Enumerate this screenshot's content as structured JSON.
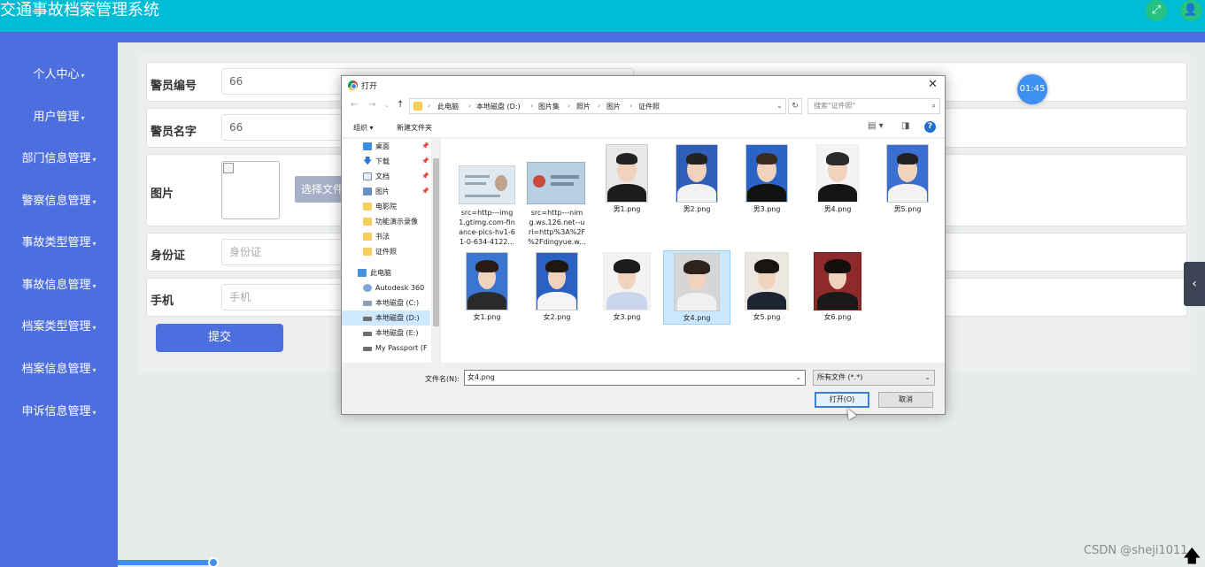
{
  "app": {
    "title": "交通事故档案管理系统",
    "timer": "01:45",
    "watermark": "CSDN @sheji1011"
  },
  "sidebar": {
    "items": [
      {
        "label": "个人中心"
      },
      {
        "label": "用户管理"
      },
      {
        "label": "部门信息管理"
      },
      {
        "label": "警察信息管理"
      },
      {
        "label": "事故类型管理"
      },
      {
        "label": "事故信息管理"
      },
      {
        "label": "档案类型管理"
      },
      {
        "label": "档案信息管理"
      },
      {
        "label": "申诉信息管理"
      }
    ]
  },
  "form": {
    "officer_no": {
      "label": "警员编号",
      "value": "66"
    },
    "officer_name": {
      "label": "警员名字",
      "value": "66"
    },
    "image": {
      "label": "图片",
      "button": "选择文件"
    },
    "id_card": {
      "label": "身份证",
      "placeholder": "身份证"
    },
    "phone": {
      "label": "手机",
      "placeholder": "手机"
    },
    "submit": "提交"
  },
  "dialog": {
    "title": "打开",
    "breadcrumb": [
      "此电脑",
      "本地磁盘 (D:)",
      "图片集",
      "照片",
      "图片",
      "证件照"
    ],
    "search_placeholder": "搜索\"证件照\"",
    "toolbar": {
      "organize": "组织 ▾",
      "new_folder": "新建文件夹"
    },
    "nav": [
      {
        "label": "桌面",
        "pinned": true
      },
      {
        "label": "下载",
        "pinned": true
      },
      {
        "label": "文档",
        "pinned": true
      },
      {
        "label": "图片",
        "pinned": true
      },
      {
        "label": "电影院"
      },
      {
        "label": "功能演示录像"
      },
      {
        "label": "书法"
      },
      {
        "label": "证件照"
      },
      {
        "label": "此电脑"
      },
      {
        "label": "Autodesk 360"
      },
      {
        "label": "本地磁盘 (C:)"
      },
      {
        "label": "本地磁盘 (D:)",
        "selected": true
      },
      {
        "label": "本地磁盘 (E:)"
      },
      {
        "label": "My Passport (F"
      }
    ],
    "files": [
      {
        "name_lines": [
          "src=http---img",
          "1.gtimg.com-fin",
          "ance-pics-hv1-6",
          "1-0-634-4122..."
        ]
      },
      {
        "name_lines": [
          "src=http---nim",
          "g.ws.126.net--u",
          "rl=http%3A%2F",
          "%2Fdingyue.w..."
        ]
      },
      {
        "name_lines": [
          "男1.png"
        ]
      },
      {
        "name_lines": [
          "男2.png"
        ]
      },
      {
        "name_lines": [
          "男3.png"
        ]
      },
      {
        "name_lines": [
          "男4.png"
        ]
      },
      {
        "name_lines": [
          "男5.png"
        ]
      },
      {
        "name_lines": [
          "女1.png"
        ]
      },
      {
        "name_lines": [
          "女2.png"
        ]
      },
      {
        "name_lines": [
          "女3.png"
        ]
      },
      {
        "name_lines": [
          "女4.png"
        ],
        "selected": true
      },
      {
        "name_lines": [
          "女5.png"
        ]
      },
      {
        "name_lines": [
          "女6.png"
        ]
      }
    ],
    "filename_label": "文件名(N):",
    "filename_value": "女4.png",
    "file_type": "所有文件 (*.*)",
    "open_button": "打开(O)",
    "cancel_button": "取消"
  }
}
